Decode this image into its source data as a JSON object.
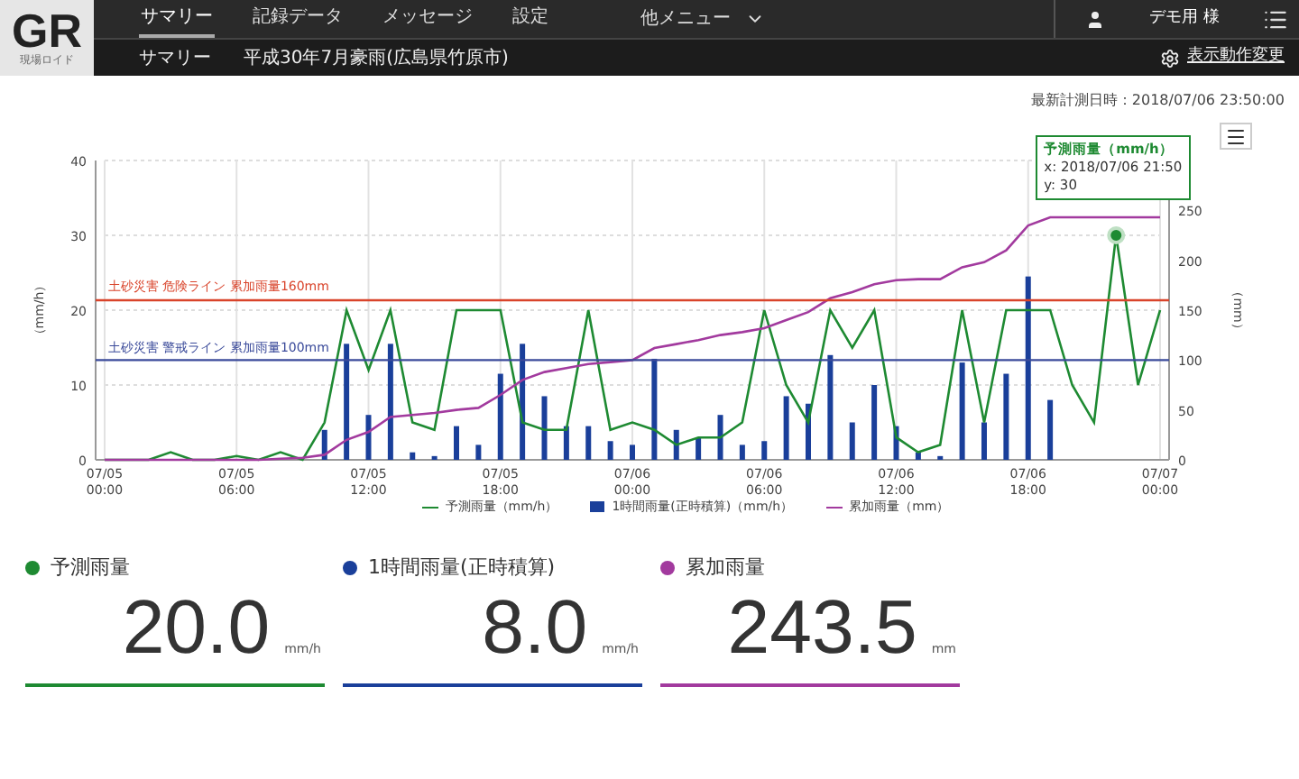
{
  "header": {
    "logo": {
      "text": "GR",
      "subtitle": "現場ロイド"
    },
    "nav": [
      {
        "label": "サマリー",
        "selected": true
      },
      {
        "label": "記録データ",
        "selected": false
      },
      {
        "label": "メッセージ",
        "selected": false
      },
      {
        "label": "設定",
        "selected": false
      }
    ],
    "more_menu": "他メニュー",
    "user": "デモ用 様",
    "breadcrumb": {
      "section": "サマリー",
      "title": "平成30年7月豪雨(広島県竹原市)"
    },
    "settings_link": "表示動作変更"
  },
  "last_updated": "最新計測日時：2018/07/06 23:50:00",
  "chart": {
    "chart_data": {
      "type": "line",
      "ylabel": "（mm/h）",
      "y2label": "（mm）",
      "categories": [
        "07/05 00:00",
        null,
        null,
        null,
        null,
        null,
        "07/05 06:00",
        null,
        null,
        null,
        null,
        null,
        "07/05 12:00",
        null,
        null,
        null,
        null,
        null,
        "07/05 18:00",
        null,
        null,
        null,
        null,
        null,
        "07/06 00:00",
        null,
        null,
        null,
        null,
        null,
        "07/06 06:00",
        null,
        null,
        null,
        null,
        null,
        "07/06 12:00",
        null,
        null,
        null,
        null,
        null,
        "07/06 18:00",
        null,
        null,
        null,
        null,
        null,
        "07/07 00:00"
      ],
      "ylim": [
        0,
        40
      ],
      "y2lim": [
        0,
        300
      ],
      "yticks": [
        0,
        10,
        20,
        30,
        40
      ],
      "y2ticks": [
        0,
        50,
        100,
        150,
        200,
        250
      ],
      "series": [
        {
          "name": "予測雨量（mm/h）",
          "color": "#1e8a32",
          "values": [
            0,
            0,
            0,
            1,
            0,
            0,
            0.5,
            0,
            1,
            0,
            5,
            20,
            12,
            20,
            5,
            4,
            20,
            20,
            20,
            5,
            4,
            4,
            20,
            4,
            5,
            4,
            2,
            3,
            3,
            5,
            20,
            10,
            5,
            20,
            15,
            20,
            3,
            1,
            2,
            20,
            5,
            20,
            20,
            20,
            10,
            5,
            30,
            10,
            20
          ]
        },
        {
          "name": "1時間雨量(正時積算)（mm/h）",
          "type": "bar",
          "color": "#1a3f9a",
          "values": [
            null,
            null,
            null,
            null,
            null,
            null,
            null,
            null,
            null,
            null,
            4,
            15.5,
            6,
            15.5,
            1,
            0.5,
            4.5,
            2,
            11.5,
            15.5,
            8.5,
            4.5,
            4.5,
            2.5,
            2,
            13.5,
            4,
            3,
            6,
            2,
            2.5,
            8.5,
            7.5,
            14,
            5,
            10,
            4.5,
            1,
            0.5,
            13,
            5,
            11.5,
            24.5,
            8,
            null,
            null,
            null,
            null,
            null
          ]
        },
        {
          "name": "累加雨量（mm）",
          "axis": "y2",
          "color": "#a23a9e",
          "values": [
            0,
            0,
            0,
            0,
            0,
            0,
            0,
            0,
            1,
            2,
            5,
            20,
            28,
            43,
            45,
            47,
            50,
            52,
            65,
            80,
            88,
            92,
            96,
            98,
            100,
            112,
            116,
            120,
            125,
            128,
            132,
            140,
            148,
            162,
            168,
            176,
            180,
            181,
            181,
            193,
            198,
            210,
            235,
            243,
            243,
            243,
            243,
            243,
            243
          ]
        }
      ],
      "ref_lines": [
        {
          "value": 160,
          "axis": "y2",
          "label": "土砂災害 危険ライン 累加雨量160mm",
          "color": "#d9442b"
        },
        {
          "value": 100,
          "axis": "y2",
          "label": "土砂災害 警戒ライン 累加雨量100mm",
          "color": "#3a4a9a"
        }
      ],
      "grid": true
    },
    "tooltip": {
      "title": "予測雨量（mm/h）",
      "lines": [
        "x: 2018/07/06 21:50",
        "y: 30"
      ]
    }
  },
  "cards": [
    {
      "label": "予測雨量",
      "value": "20.0",
      "unit": "mm/h",
      "color": "#1e8a32"
    },
    {
      "label": "1時間雨量(正時積算)",
      "value": "8.0",
      "unit": "mm/h",
      "color": "#1a3f9a"
    },
    {
      "label": "累加雨量",
      "value": "243.5",
      "unit": "mm",
      "color": "#a23a9e"
    }
  ]
}
